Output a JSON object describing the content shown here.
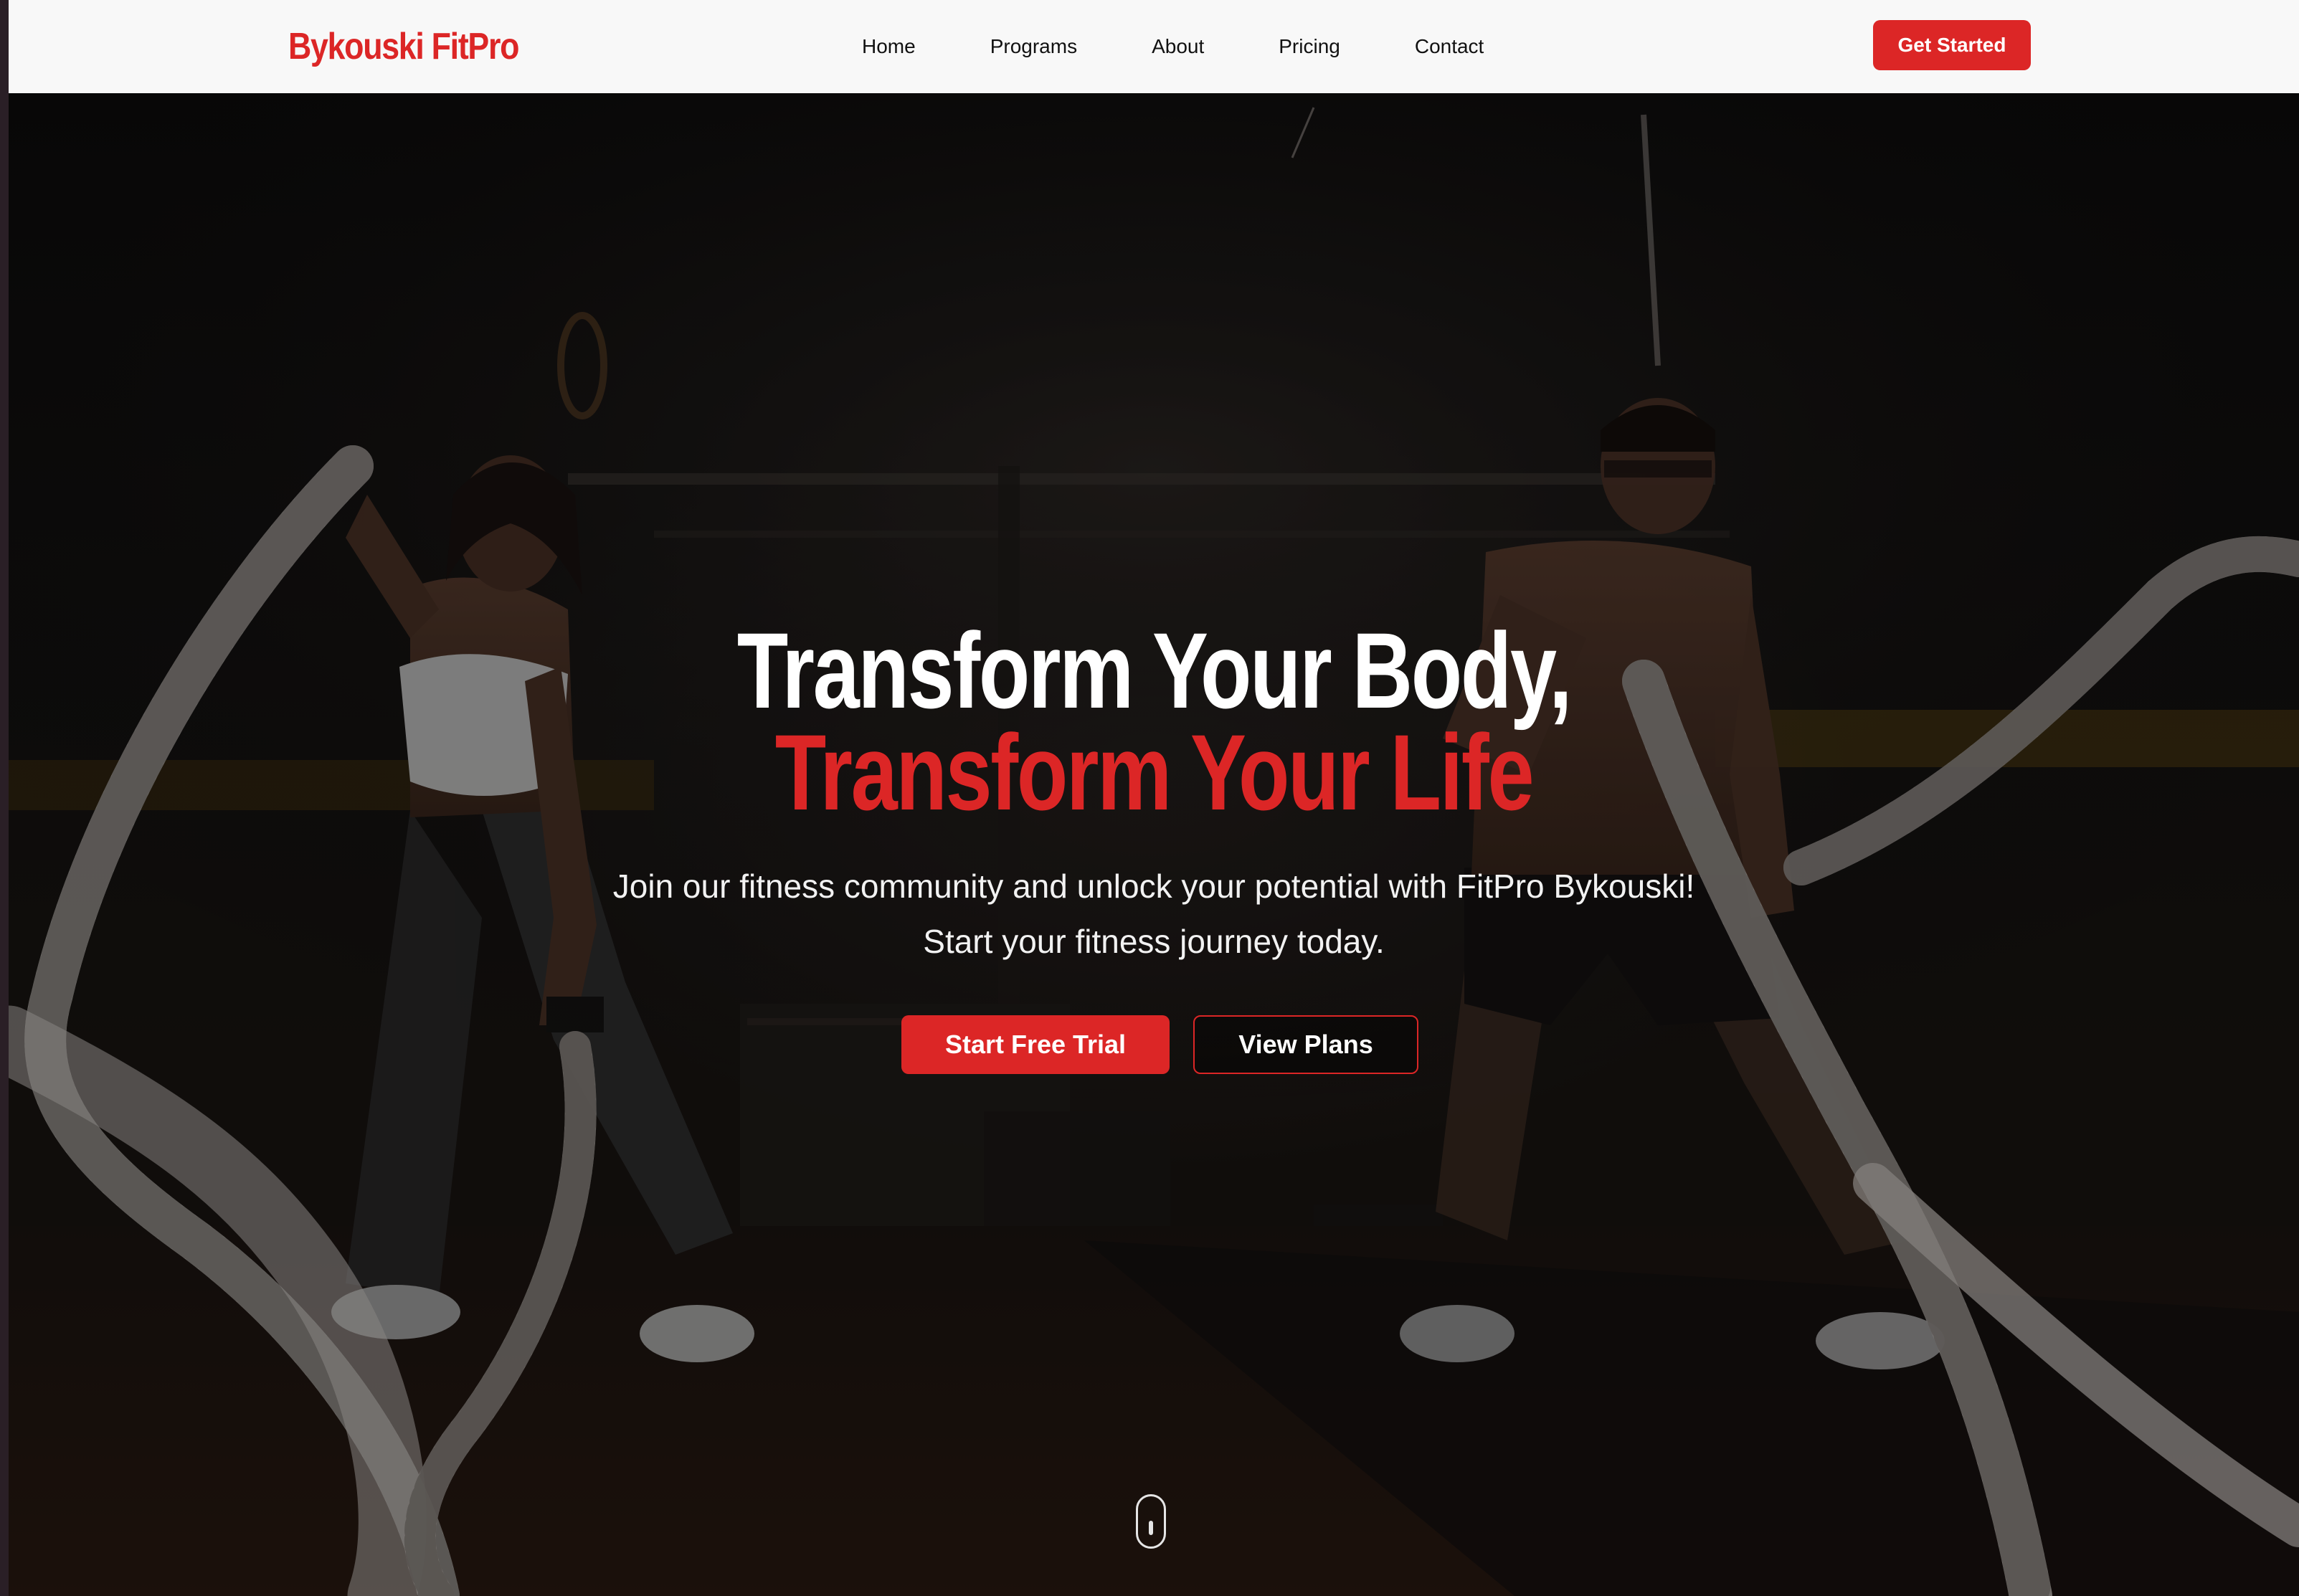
{
  "brand": {
    "name": "Bykouski FitPro",
    "accent_color": "#dc2626"
  },
  "nav": {
    "links": [
      {
        "label": "Home"
      },
      {
        "label": "Programs"
      },
      {
        "label": "About"
      },
      {
        "label": "Pricing"
      },
      {
        "label": "Contact"
      }
    ],
    "cta_label": "Get Started"
  },
  "hero": {
    "headline_line1": "Transform Your Body,",
    "headline_line2": "Transform Your Life",
    "subtext_line1": "Join our fitness community and unlock your potential with FitPro Bykouski!",
    "subtext_line2": "Start your fitness journey today.",
    "primary_button": "Start Free Trial",
    "secondary_button": "View Plans",
    "background_image": "gym-battle-ropes-photo",
    "scroll_icon": "mouse-scroll-icon"
  }
}
